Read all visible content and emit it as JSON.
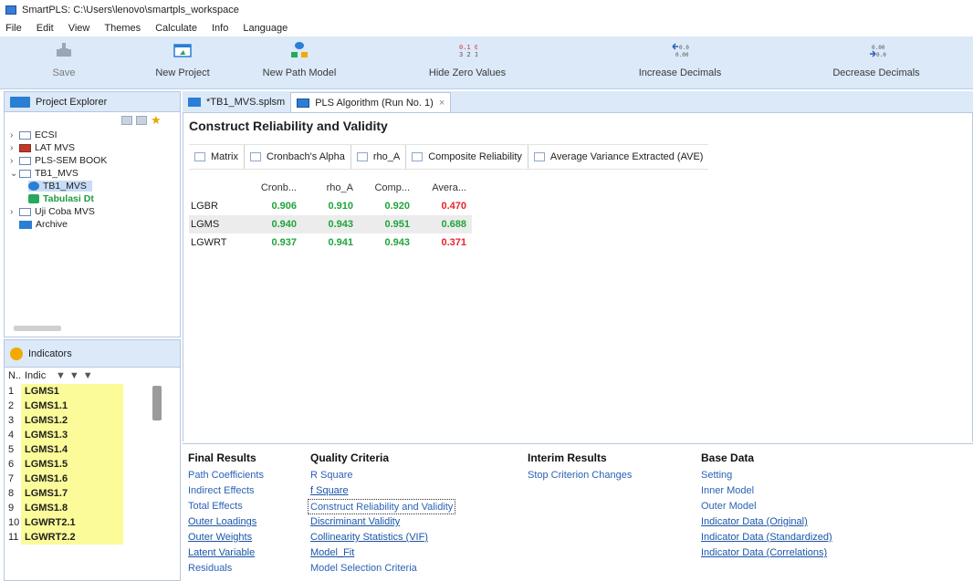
{
  "window": {
    "title": "SmartPLS: C:\\Users\\lenovo\\smartpls_workspace"
  },
  "menu": [
    "File",
    "Edit",
    "View",
    "Themes",
    "Calculate",
    "Info",
    "Language"
  ],
  "toolbar": {
    "save": "Save",
    "new_project": "New Project",
    "new_path_model": "New Path Model",
    "hide_zero": "Hide Zero Values",
    "increase_dec": "Increase Decimals",
    "decrease_dec": "Decrease Decimals"
  },
  "project_explorer": {
    "title": "Project Explorer",
    "items": [
      {
        "label": "ECSI"
      },
      {
        "label": "LAT MVS"
      },
      {
        "label": "PLS-SEM BOOK"
      },
      {
        "label": "TB1_MVS"
      },
      {
        "label": "TB1_MVS"
      },
      {
        "label": "Tabulasi Dt"
      },
      {
        "label": "Uji Coba MVS"
      },
      {
        "label": "Archive"
      }
    ]
  },
  "indicators": {
    "title": "Indicators",
    "header_no": "N..",
    "header_ind": "Indic",
    "rows": [
      {
        "n": "1",
        "name": "LGMS1"
      },
      {
        "n": "2",
        "name": "LGMS1.1"
      },
      {
        "n": "3",
        "name": "LGMS1.2"
      },
      {
        "n": "4",
        "name": "LGMS1.3"
      },
      {
        "n": "5",
        "name": "LGMS1.4"
      },
      {
        "n": "6",
        "name": "LGMS1.5"
      },
      {
        "n": "7",
        "name": "LGMS1.6"
      },
      {
        "n": "8",
        "name": "LGMS1.7"
      },
      {
        "n": "9",
        "name": "LGMS1.8"
      },
      {
        "n": "10",
        "name": "LGWRT2.1"
      },
      {
        "n": "11",
        "name": "LGWRT2.2"
      }
    ]
  },
  "tabs": [
    {
      "label": "*TB1_MVS.splsm"
    },
    {
      "label": "PLS Algorithm (Run No. 1)"
    }
  ],
  "editor": {
    "title": "Construct Reliability and Validity",
    "subtabs": [
      "Matrix",
      "Cronbach's Alpha",
      "rho_A",
      "Composite Reliability",
      "Average Variance Extracted (AVE)"
    ],
    "columns": [
      "Cronb...",
      "rho_A",
      "Comp...",
      "Avera..."
    ],
    "rows": [
      {
        "label": "LGBR",
        "values": [
          "0.906",
          "0.910",
          "0.920",
          "0.470"
        ]
      },
      {
        "label": "LGMS",
        "values": [
          "0.940",
          "0.943",
          "0.951",
          "0.688"
        ]
      },
      {
        "label": "LGWRT",
        "values": [
          "0.937",
          "0.941",
          "0.943",
          "0.371"
        ]
      }
    ],
    "colors": {
      "good": "#1fa53a",
      "bad": "#e8232a"
    }
  },
  "nav": {
    "final_results": {
      "title": "Final Results",
      "links": [
        "Path Coefficients",
        "Indirect Effects",
        "Total Effects",
        "Outer Loadings",
        "Outer Weights",
        "Latent Variable",
        "Residuals"
      ]
    },
    "quality_criteria": {
      "title": "Quality Criteria",
      "links": [
        "R Square",
        "f Square",
        "Construct Reliability and Validity",
        "Discriminant Validity",
        "Collinearity Statistics (VIF)",
        "Model_Fit",
        "Model Selection Criteria"
      ]
    },
    "interim_results": {
      "title": "Interim Results",
      "links": [
        "Stop Criterion Changes"
      ]
    },
    "base_data": {
      "title": "Base Data",
      "links": [
        "Setting",
        "Inner Model",
        "Outer Model",
        "Indicator Data (Original)",
        "Indicator Data (Standardized)",
        "Indicator Data (Correlations)"
      ]
    }
  }
}
